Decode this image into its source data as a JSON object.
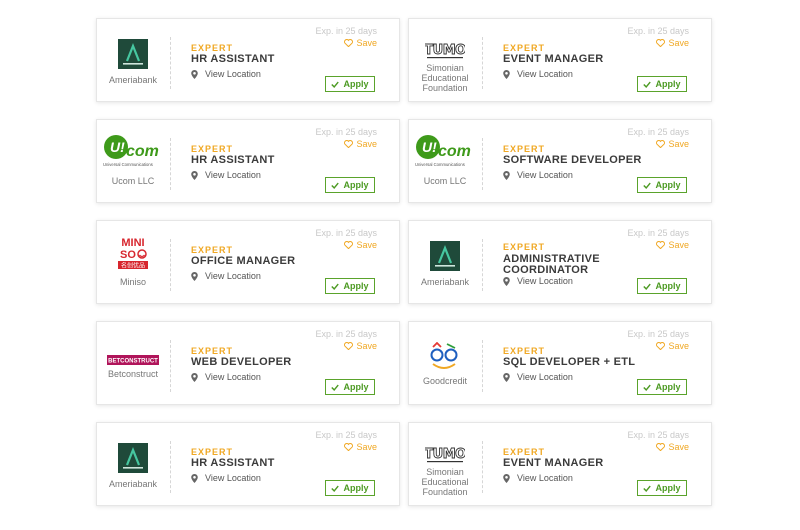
{
  "colors": {
    "accent": "#f0a824",
    "apply": "#4c9a22",
    "ameria": "#1f4a3a",
    "ucom": "#3e9a1a",
    "miniso": "#d7262e",
    "betconstruct": "#b0145a"
  },
  "jobs": [
    {
      "company": "Ameriabank",
      "logo": "ameriabank-logo",
      "level": "EXPERT",
      "title": [
        "HR ASSISTANT"
      ],
      "location": "View Location",
      "expires": "Exp. in 25 days",
      "save": "Save",
      "apply": "Apply"
    },
    {
      "company": [
        "Simonian",
        "Educational",
        "Foundation"
      ],
      "logo": "tumo-logo",
      "level": "EXPERT",
      "title": [
        "EVENT MANAGER"
      ],
      "location": "View Location",
      "expires": "Exp. in 25 days",
      "save": "Save",
      "apply": "Apply"
    },
    {
      "company": "Ucom LLC",
      "logo": "ucom-logo",
      "level": "EXPERT",
      "title": [
        "HR ASSISTANT"
      ],
      "location": "View Location",
      "expires": "Exp. in 25 days",
      "save": "Save",
      "apply": "Apply"
    },
    {
      "company": "Ucom LLC",
      "logo": "ucom-logo",
      "level": "EXPERT",
      "title": [
        "SOFTWARE DEVELOPER"
      ],
      "location": "View Location",
      "expires": "Exp. in 25 days",
      "save": "Save",
      "apply": "Apply"
    },
    {
      "company": "Miniso",
      "logo": "miniso-logo",
      "level": "EXPERT",
      "title": [
        "OFFICE MANAGER"
      ],
      "location": "View Location",
      "expires": "Exp. in 25 days",
      "save": "Save",
      "apply": "Apply"
    },
    {
      "company": "Ameriabank",
      "logo": "ameriabank-logo",
      "level": "EXPERT",
      "title": [
        "ADMINISTRATIVE",
        "COORDINATOR"
      ],
      "location": "View Location",
      "expires": "Exp. in 25 days",
      "save": "Save",
      "apply": "Apply"
    },
    {
      "company": "Betconstruct",
      "logo": "betconstruct-logo",
      "level": "EXPERT",
      "title": [
        "WEB DEVELOPER"
      ],
      "location": "View Location",
      "expires": "Exp. in 25 days",
      "save": "Save",
      "apply": "Apply"
    },
    {
      "company": "Goodcredit",
      "logo": "goodcredit-logo",
      "level": "EXPERT",
      "title": [
        "SQL DEVELOPER + ETL"
      ],
      "location": "View Location",
      "expires": "Exp. in 25 days",
      "save": "Save",
      "apply": "Apply"
    },
    {
      "company": "Ameriabank",
      "logo": "ameriabank-logo",
      "level": "EXPERT",
      "title": [
        "HR ASSISTANT"
      ],
      "location": "View Location",
      "expires": "Exp. in 25 days",
      "save": "Save",
      "apply": "Apply"
    },
    {
      "company": [
        "Simonian",
        "Educational",
        "Foundation"
      ],
      "logo": "tumo-logo",
      "level": "EXPERT",
      "title": [
        "EVENT MANAGER"
      ],
      "location": "View Location",
      "expires": "Exp. in 25 days",
      "save": "Save",
      "apply": "Apply"
    }
  ],
  "logo_text": {
    "ucom_main": "U!com",
    "ucom_sub": "Universal Communications",
    "miniso_top": "MINI",
    "miniso_mid": "SO",
    "miniso_bottom": "名创优品",
    "betconstruct": "BETCONSTRUCT",
    "tumo": "TUMO"
  }
}
